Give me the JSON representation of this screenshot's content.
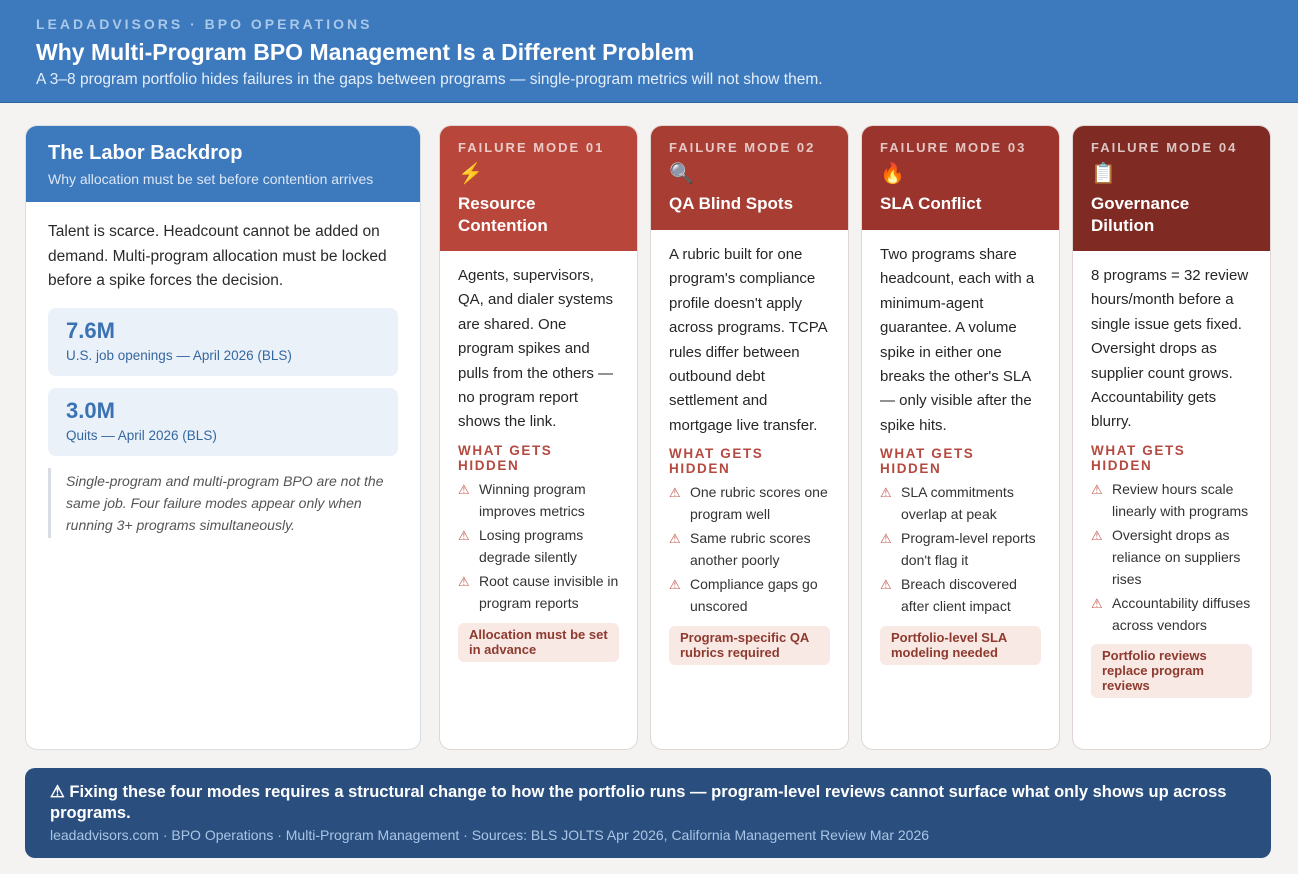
{
  "header": {
    "eyebrow": "LEADADVISORS · BPO OPERATIONS",
    "title": "Why Multi-Program BPO Management Is a Different Problem",
    "subtitle": "A 3–8 program portfolio hides failures in the gaps between programs — single-program metrics will not show them."
  },
  "labor": {
    "title": "The Labor Backdrop",
    "subtitle": "Why allocation must be set before contention arrives",
    "text": "Talent is scarce. Headcount cannot be added on demand. Multi-program allocation must be locked before a spike forces the decision.",
    "stats": [
      {
        "value": "7.6M",
        "label": "U.S. job openings — April 2026 (BLS)"
      },
      {
        "value": "3.0M",
        "label": "Quits — April 2026 (BLS)"
      }
    ],
    "note": "Single-program and multi-program BPO are not the same job. Four failure modes appear only when running 3+ programs simultaneously."
  },
  "hidden_heading": "WHAT GETS HIDDEN",
  "warn_glyph": "⚠",
  "failures": [
    {
      "eyebrow": "FAILURE MODE 01",
      "icon": "⚡",
      "icon_name": "lightning-icon",
      "title": "Resource Contention",
      "color": "#b8463a",
      "description": "Agents, supervisors, QA, and dialer systems are shared. One program spikes and pulls from the others — no program report shows the link.",
      "hidden": [
        "Winning program improves metrics",
        "Losing programs degrade silently",
        "Root cause invisible in program reports"
      ],
      "tag": "Allocation must be set in advance"
    },
    {
      "eyebrow": "FAILURE MODE 02",
      "icon": "🔍",
      "icon_name": "magnifier-icon",
      "title": "QA Blind Spots",
      "color": "#a73d33",
      "description": "A rubric built for one program's compliance profile doesn't apply across programs. TCPA rules differ between outbound debt settlement and mortgage live transfer.",
      "hidden": [
        "One rubric scores one program well",
        "Same rubric scores another poorly",
        "Compliance gaps go unscored"
      ],
      "tag": "Program-specific QA rubrics required"
    },
    {
      "eyebrow": "FAILURE MODE 03",
      "icon": "🔥",
      "icon_name": "fire-icon",
      "title": "SLA Conflict",
      "color": "#9a342c",
      "description": "Two programs share headcount, each with a minimum-agent guarantee. A volume spike in either one breaks the other's SLA — only visible after the spike hits.",
      "hidden": [
        "SLA commitments overlap at peak",
        "Program-level reports don't flag it",
        "Breach discovered after client impact"
      ],
      "tag": "Portfolio-level SLA modeling needed"
    },
    {
      "eyebrow": "FAILURE MODE 04",
      "icon": "📋",
      "icon_name": "clipboard-icon",
      "title": "Governance Dilution",
      "color": "#7f2b24",
      "description": "8 programs = 32 review hours/month before a single issue gets fixed. Oversight drops as supplier count grows. Accountability gets blurry.",
      "hidden": [
        "Review hours scale linearly with programs",
        "Oversight drops as reliance on suppliers rises",
        "Accountability diffuses across vendors"
      ],
      "tag": "Portfolio reviews replace program reviews"
    }
  ],
  "footer": {
    "main": "⚠ Fixing these four modes requires a structural change to how the portfolio runs — program-level reviews cannot surface what only shows up across programs.",
    "sources": "leadadvisors.com · BPO Operations · Multi-Program Management · Sources: BLS JOLTS Apr 2026, California Management Review Mar 2026"
  }
}
